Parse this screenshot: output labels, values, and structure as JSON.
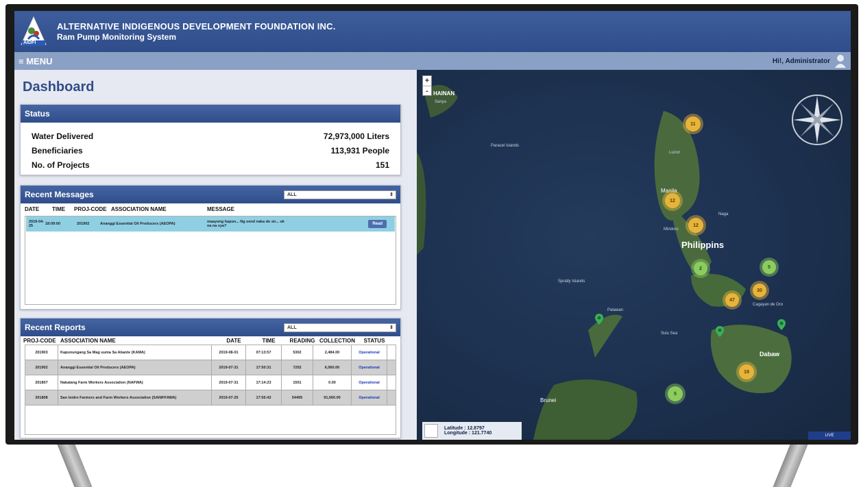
{
  "header": {
    "org_title": "ALTERNATIVE INDIGENOUS DEVELOPMENT FOUNDATION INC.",
    "system_title": "Ram Pump Monitoring System",
    "logo_text": "AIDFI"
  },
  "menubar": {
    "menu_label": "≡ MENU",
    "greeting": "Hi!, Administrator"
  },
  "page_title": "Dashboard",
  "status": {
    "title": "Status",
    "rows": [
      {
        "label": "Water Delivered",
        "value": "72,973,000 Liters"
      },
      {
        "label": "Beneficiaries",
        "value": "113,931 People"
      },
      {
        "label": "No. of Projects",
        "value": "151"
      }
    ]
  },
  "messages": {
    "title": "Recent Messages",
    "filter": "ALL",
    "columns": [
      "DATE",
      "TIME",
      "PROJ-CODE",
      "ASSOCIATION NAME",
      "MESSAGE"
    ],
    "rows": [
      {
        "date": "2019-04-25",
        "time": "18:09:00",
        "code": "201902",
        "assoc": "Ananggi Essential Oil Producers (AEOPA)",
        "message": "maayong hapon... Ng send naka do sir... ok na na sya?",
        "action": "Read"
      }
    ]
  },
  "reports": {
    "title": "Recent Reports",
    "filter": "ALL",
    "columns": [
      "PROJ-CODE",
      "ASSOCIATION NAME",
      "DATE",
      "TIME",
      "READING",
      "COLLECTION",
      "STATUS"
    ],
    "rows": [
      {
        "code": "201903",
        "assoc": "Kapunungang Sa Mag uuma Sa Abante (KAMA)",
        "date": "2019-08-01",
        "time": "07:13:57",
        "reading": "5302",
        "collection": "2,484.00",
        "status": "Operational"
      },
      {
        "code": "201902",
        "assoc": "Ananggi Essential Oil Producers (AEOPA)",
        "date": "2019-07-31",
        "time": "17:50:31",
        "reading": "7202",
        "collection": "6,060.00",
        "status": "Operational"
      },
      {
        "code": "201807",
        "assoc": "Nakalang Farm Workers Association (NAFWA)",
        "date": "2019-07-31",
        "time": "17:14:23",
        "reading": "1501",
        "collection": "0.00",
        "status": "Operational"
      },
      {
        "code": "201808",
        "assoc": "San Isidro Farmers and Farm Workers Association (SANIFFAWA)",
        "date": "2019-07-25",
        "time": "17:56:42",
        "reading": "54495",
        "collection": "91,560.00",
        "status": "Operational"
      }
    ]
  },
  "map": {
    "labels": {
      "hainan": "HAINAN",
      "sanya": "Sanya",
      "philippines": "Philippins",
      "manila": "Manila",
      "luzon": "Luzon",
      "dabaw": "Dabaw",
      "palawan": "Palawan",
      "sulu_sea": "Sulu Sea",
      "brunei": "Brunei",
      "mindoro": "Mindoro",
      "naga": "Naga",
      "cagayan": "Cagayan de Oro",
      "spratly": "Spratly Islands",
      "paracel": "Paracel Islands"
    },
    "clusters": [
      {
        "label": "11",
        "color": "y"
      },
      {
        "label": "12",
        "color": "y"
      },
      {
        "label": "12",
        "color": "y"
      },
      {
        "label": "2",
        "color": "g"
      },
      {
        "label": "5",
        "color": "g"
      },
      {
        "label": "30",
        "color": "y"
      },
      {
        "label": "47",
        "color": "y"
      },
      {
        "label": "19",
        "color": "y"
      },
      {
        "label": "5",
        "color": "g"
      }
    ],
    "latitude_text": "Latitude : 12.8797",
    "longitude_text": "Longitude : 121.7740",
    "zoom_in": "+",
    "zoom_out": "-",
    "live_label": "LIVE"
  }
}
